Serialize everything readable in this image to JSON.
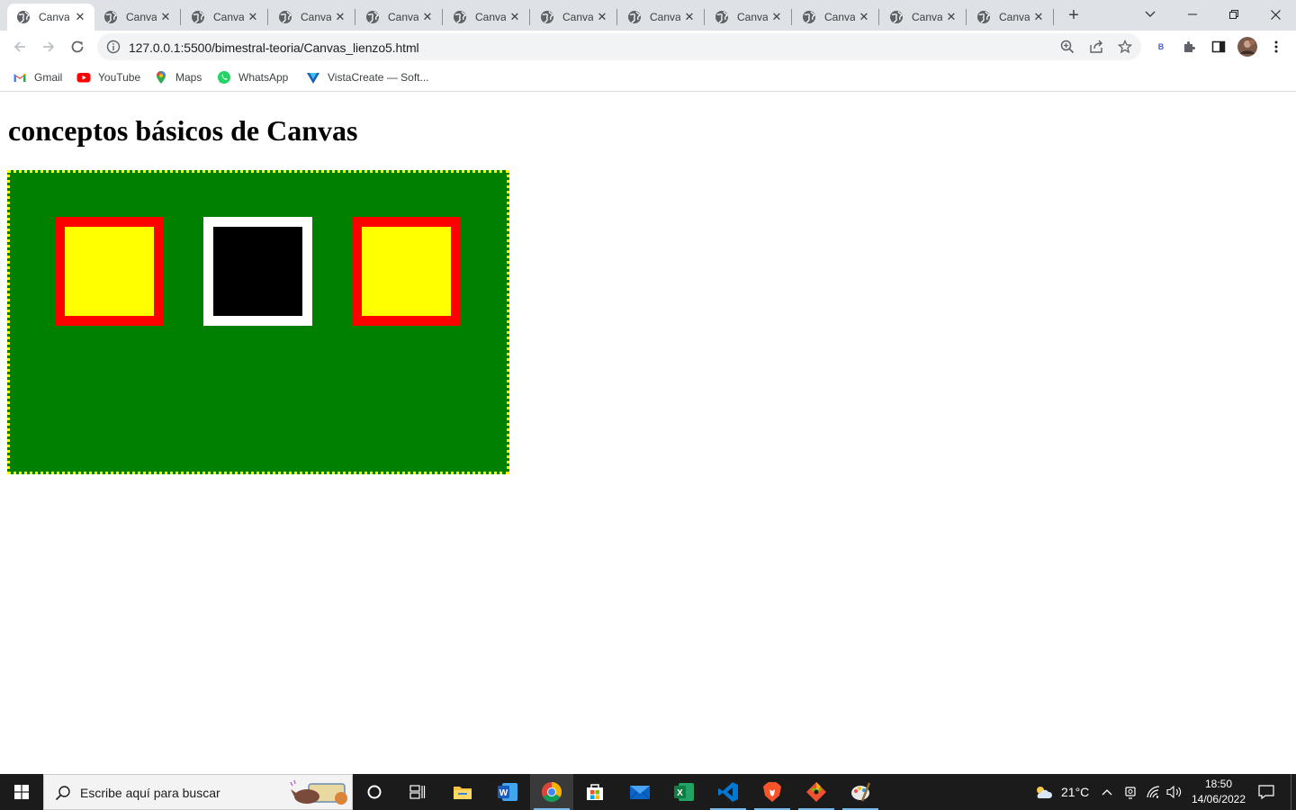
{
  "browser": {
    "tabs": [
      {
        "title": "Canvas",
        "active": true
      },
      {
        "title": "Canvas",
        "active": false
      },
      {
        "title": "Canvas",
        "active": false
      },
      {
        "title": "Canvas",
        "active": false
      },
      {
        "title": "Canvas",
        "active": false
      },
      {
        "title": "Canvas",
        "active": false
      },
      {
        "title": "Canvas",
        "active": false
      },
      {
        "title": "Canvas",
        "active": false
      },
      {
        "title": "Canvas",
        "active": false
      },
      {
        "title": "Canvas",
        "active": false
      },
      {
        "title": "Canvas",
        "active": false
      },
      {
        "title": "Canvas",
        "active": false
      }
    ],
    "url": "127.0.0.1:5500/bimestral-teoria/Canvas_lienzo5.html",
    "profile_badge": "B",
    "bookmarks": [
      {
        "label": "Gmail",
        "icon": "gmail-icon"
      },
      {
        "label": "YouTube",
        "icon": "youtube-icon"
      },
      {
        "label": "Maps",
        "icon": "maps-icon"
      },
      {
        "label": "WhatsApp",
        "icon": "whatsapp-icon"
      },
      {
        "label": "VistaCreate — Soft...",
        "icon": "vistacreate-icon"
      }
    ]
  },
  "page": {
    "heading": "conceptos básicos de Canvas",
    "canvas": {
      "background": "#008000",
      "border_color": "#ffff00",
      "squares": [
        {
          "name": "square-left",
          "outer": "#ff0000",
          "inner": "#ffff00"
        },
        {
          "name": "square-middle",
          "outer": "#ffffff",
          "inner": "#000000"
        },
        {
          "name": "square-right",
          "outer": "#ff0000",
          "inner": "#ffff00"
        }
      ]
    }
  },
  "taskbar": {
    "search_placeholder": "Escribe aquí para buscar",
    "apps": [
      "cortana-icon",
      "task-view-icon",
      "file-explorer-icon",
      "word-icon",
      "chrome-icon",
      "store-icon",
      "mail-icon",
      "excel-icon",
      "vscode-icon",
      "brave-icon",
      "git-icon",
      "paint-icon"
    ],
    "weather": "21°C",
    "time": "18:50",
    "date": "14/06/2022"
  }
}
